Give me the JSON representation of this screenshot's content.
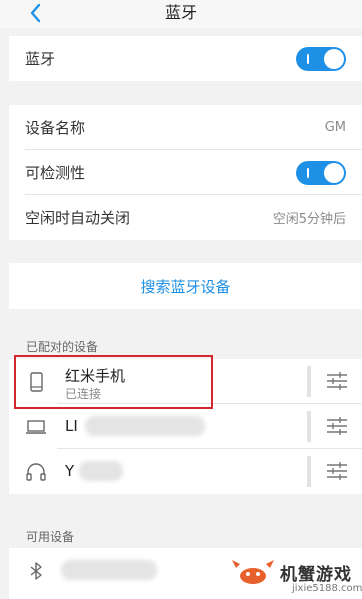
{
  "nav": {
    "title": "蓝牙"
  },
  "bluetooth": {
    "label": "蓝牙",
    "enabled": true
  },
  "device_info": {
    "name_label": "设备名称",
    "name_value": "GM",
    "visibility_label": "可检测性",
    "visibility_enabled": true,
    "auto_off_label": "空闲时自动关闭",
    "auto_off_value": "空闲5分钟后"
  },
  "search_label": "搜索蓝牙设备",
  "paired": {
    "section_label": "已配对的设备",
    "devices": [
      {
        "name": "红米手机",
        "status": "已连接",
        "icon": "phone-icon"
      },
      {
        "name": "LI",
        "status": "",
        "icon": "laptop-icon"
      },
      {
        "name": "Y",
        "status": "",
        "icon": "headphones-icon"
      }
    ]
  },
  "available": {
    "section_label": "可用设备",
    "devices": [
      {
        "name": "",
        "icon": "bluetooth-icon"
      }
    ]
  },
  "watermark": {
    "name": "机蟹游戏",
    "url": "jixie5188.com"
  },
  "colors": {
    "accent": "#1e90e6",
    "highlight": "#d0282e",
    "background": "#f2f2f2"
  }
}
